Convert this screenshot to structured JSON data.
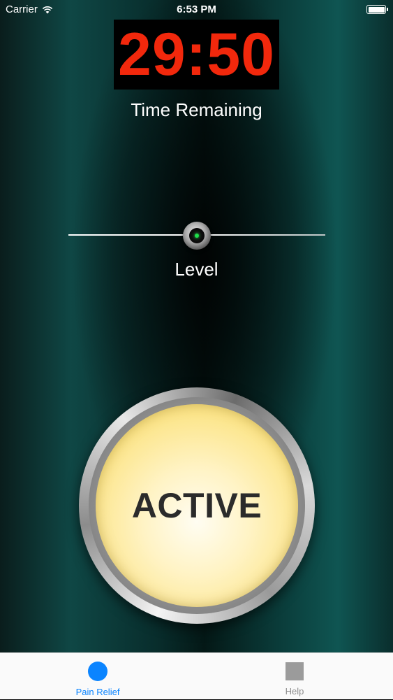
{
  "status_bar": {
    "carrier": "Carrier",
    "time": "6:53 PM",
    "icons": [
      "wifi-icon",
      "battery-icon"
    ]
  },
  "timer": {
    "value": "29:50",
    "label": "Time Remaining",
    "digit_color": "#f2280c"
  },
  "level": {
    "label": "Level",
    "value_fraction": 0.5
  },
  "button": {
    "label": "ACTIVE",
    "color": "#fce58a"
  },
  "tabs": [
    {
      "label": "Pain Relief",
      "icon": "circle-icon",
      "selected": true,
      "color": "#0a84ff"
    },
    {
      "label": "Help",
      "icon": "square-icon",
      "selected": false,
      "color": "#8e8e8e"
    }
  ]
}
